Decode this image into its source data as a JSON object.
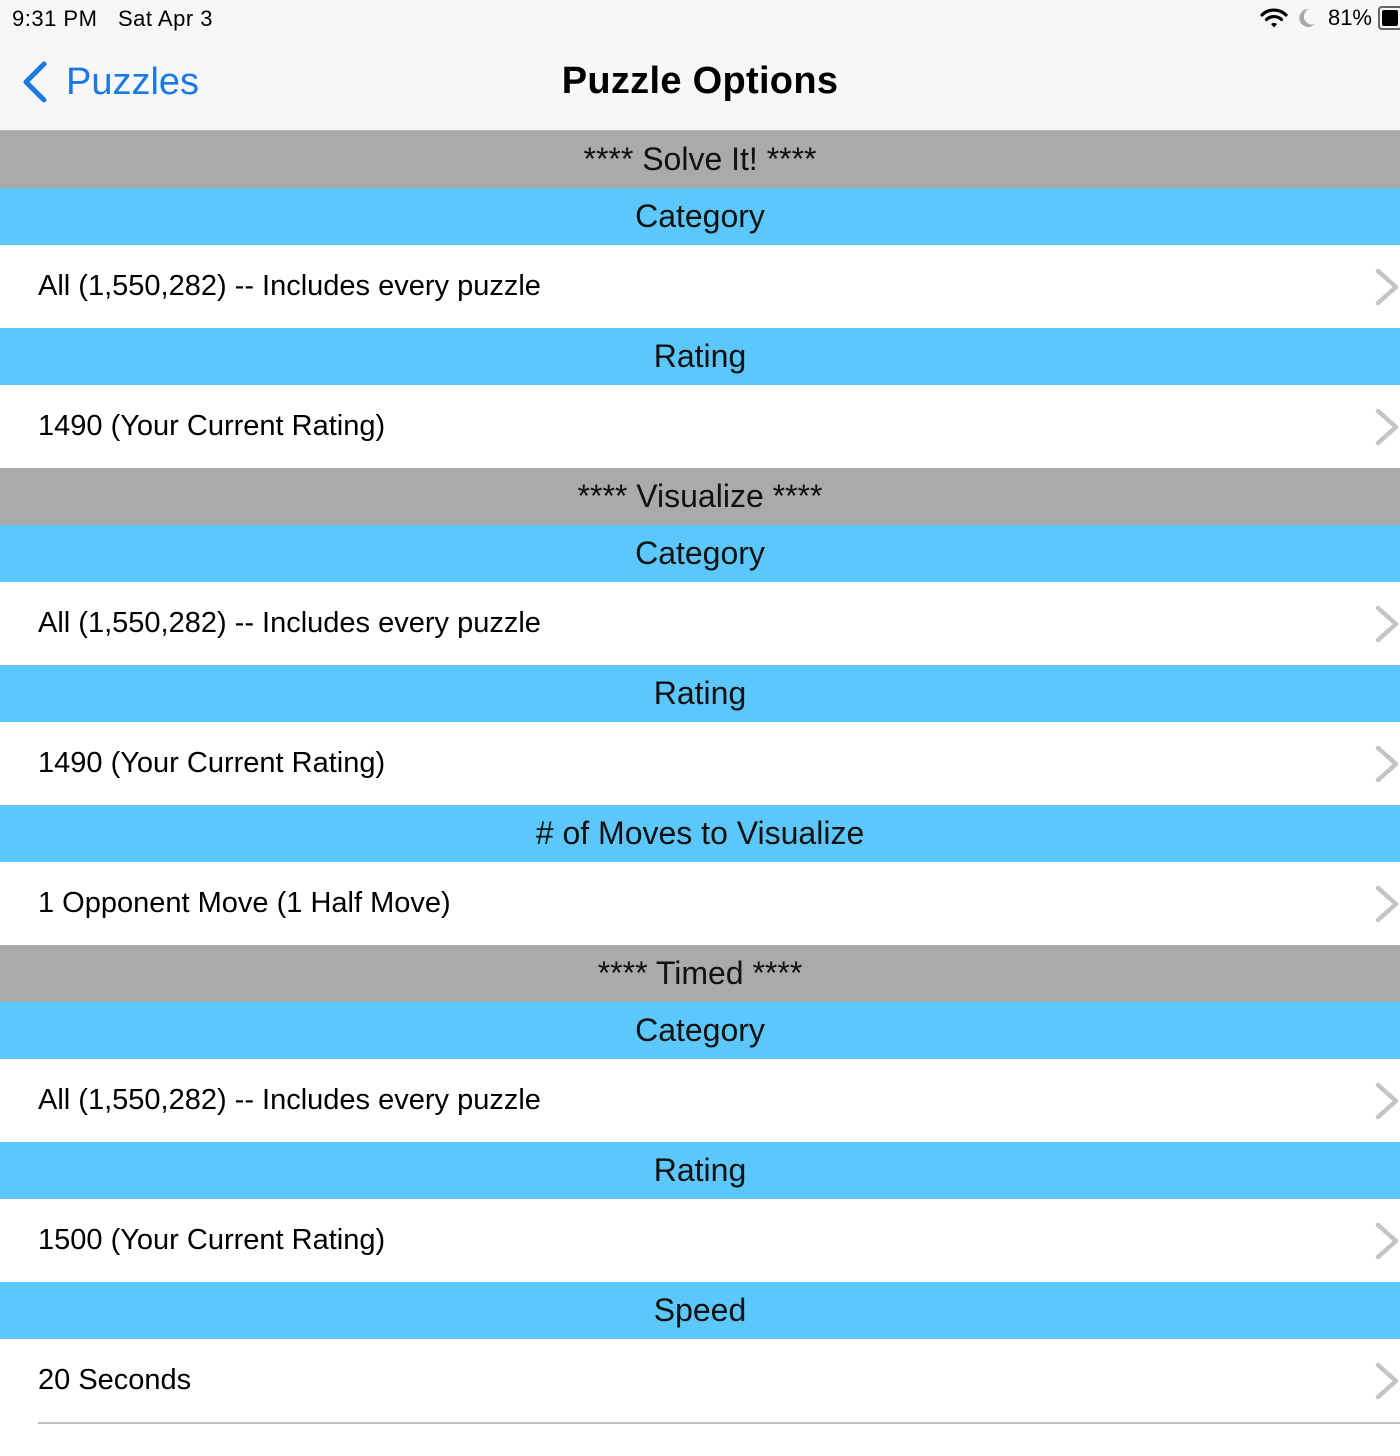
{
  "status_bar": {
    "time": "9:31 PM",
    "date": "Sat Apr 3",
    "battery_percent": "81%",
    "icons": [
      "wifi-icon",
      "moon-icon",
      "battery-icon"
    ]
  },
  "nav": {
    "back_label": "Puzzles",
    "back_icon": "chevron-left-icon",
    "title": "Puzzle Options"
  },
  "colors": {
    "accent_blue": "#1a7ae2",
    "section_gray": "#aaaaaa",
    "group_blue": "#5bc7fa"
  },
  "sections": [
    {
      "title": "**** Solve It! ****",
      "groups": [
        {
          "header": "Category",
          "value": "All (1,550,282) -- Includes every puzzle"
        },
        {
          "header": "Rating",
          "value": "1490 (Your Current Rating)"
        }
      ]
    },
    {
      "title": "**** Visualize ****",
      "groups": [
        {
          "header": "Category",
          "value": "All (1,550,282) -- Includes every puzzle"
        },
        {
          "header": "Rating",
          "value": "1490 (Your Current Rating)"
        },
        {
          "header": "# of Moves to Visualize",
          "value": "1 Opponent Move (1 Half Move)"
        }
      ]
    },
    {
      "title": "**** Timed ****",
      "groups": [
        {
          "header": "Category",
          "value": "All (1,550,282) -- Includes every puzzle"
        },
        {
          "header": "Rating",
          "value": "1500 (Your Current Rating)"
        },
        {
          "header": "Speed",
          "value": "20 Seconds"
        }
      ]
    }
  ]
}
